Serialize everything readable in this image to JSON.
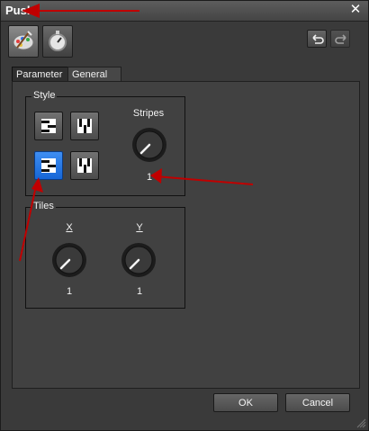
{
  "window": {
    "title": "Push",
    "close_glyph": "✕",
    "tabs": [
      {
        "label": "Parameter"
      },
      {
        "label": "General"
      }
    ],
    "toolbar": {
      "effect_icon": "palette-icon",
      "timing_icon": "stopwatch-icon",
      "undo_icon": "undo-icon",
      "redo_icon": "redo-icon"
    }
  },
  "style_group": {
    "label": "Style",
    "buttons": [
      {
        "name": "horizontal-stripes-style",
        "selected": false
      },
      {
        "name": "vertical-checker-style",
        "selected": false
      },
      {
        "name": "horizontal-stripes-style-alt",
        "selected": true
      },
      {
        "name": "vertical-checker-style-alt",
        "selected": false
      }
    ],
    "stripes_label": "Stripes",
    "stripes_value": "1"
  },
  "tiles_group": {
    "label": "Tiles",
    "x_label": "X",
    "x_value": "1",
    "y_label": "Y",
    "y_value": "1"
  },
  "footer": {
    "ok_label": "OK",
    "cancel_label": "Cancel"
  },
  "annotation_colors": {
    "arrow": "#c00000"
  }
}
